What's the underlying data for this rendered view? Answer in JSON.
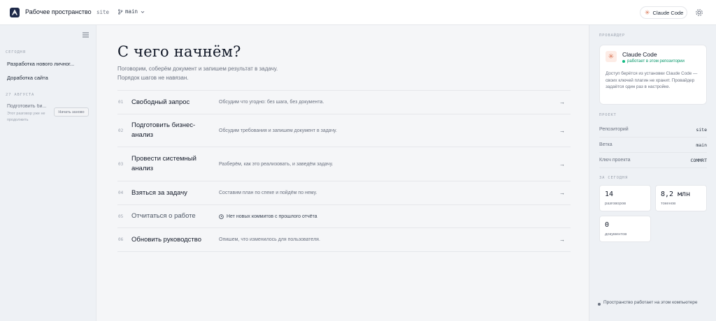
{
  "header": {
    "workspace_title": "Рабочее пространство",
    "repo": "site",
    "branch": "main",
    "provider_button": "Claude Code",
    "icons": {
      "logo": "workspace-logo-icon",
      "branch": "git-branch-icon",
      "chevron": "chevron-down-icon",
      "settings": "gear-icon"
    }
  },
  "sidebar": {
    "sections": [
      {
        "label": "СЕГОДНЯ",
        "items": [
          {
            "label": "Разработка нового личног..."
          },
          {
            "label": "Доработка сайта"
          }
        ]
      },
      {
        "label": "27 АВГУСТА",
        "items": [
          {
            "label": "Подготовить би...",
            "subtitle": "Этот разговор уже не продолжить",
            "action": "Начать заново"
          }
        ]
      }
    ]
  },
  "main": {
    "title": "С чего начнём?",
    "subtitle_1": "Поговорим, соберём документ и запишем результат в задачу.",
    "subtitle_2": "Порядок шагов не навязан.",
    "options": [
      {
        "num": "01",
        "title": "Свободный запрос",
        "desc": "Обсудим что угодно: без шага, без документа.",
        "arrow": "→"
      },
      {
        "num": "02",
        "title": "Подготовить бизнес-анализ",
        "desc": "Обсудим требования и запишем документ в задачу.",
        "arrow": "→"
      },
      {
        "num": "03",
        "title": "Провести системный анализ",
        "desc": "Разберём, как это реализовать, и заведём задачу.",
        "arrow": "→"
      },
      {
        "num": "04",
        "title": "Взяться за задачу",
        "desc": "Составим план по спеке и пойдём по нему.",
        "arrow": "→"
      },
      {
        "num": "05",
        "title": "Отчитаться о работе",
        "desc": "Нет новых коммитов с прошлого отчёта",
        "arrow": "",
        "disabled": true
      },
      {
        "num": "06",
        "title": "Обновить руководство",
        "desc": "Опишем, что изменилось для пользователя.",
        "arrow": "→"
      }
    ]
  },
  "right": {
    "provider_label": "ПРОВАЙДЕР",
    "provider": {
      "name": "Claude Code",
      "status": "работает в этом репозитории",
      "desc": "Доступ берётся из установки Claude Code — своих ключей плагин не хранит. Провайдер задаётся один раз в настройке."
    },
    "project_label": "ПРОЕКТ",
    "project": [
      {
        "key": "Репозиторий",
        "value": "site"
      },
      {
        "key": "Ветка",
        "value": "main"
      },
      {
        "key": "Ключ проекта",
        "value": "COMMRT"
      }
    ],
    "today_label": "ЗА СЕГОДНЯ",
    "stats": [
      {
        "value": "14",
        "label": "разговоров"
      },
      {
        "value": "8,2 млн",
        "label": "токенов"
      },
      {
        "value": "0",
        "label": "документов"
      }
    ],
    "footer": "Пространство работает на этом компьютере"
  },
  "colors": {
    "accent": "#d97757",
    "status_green": "#059669",
    "logo_bg": "#1e2a4a"
  }
}
